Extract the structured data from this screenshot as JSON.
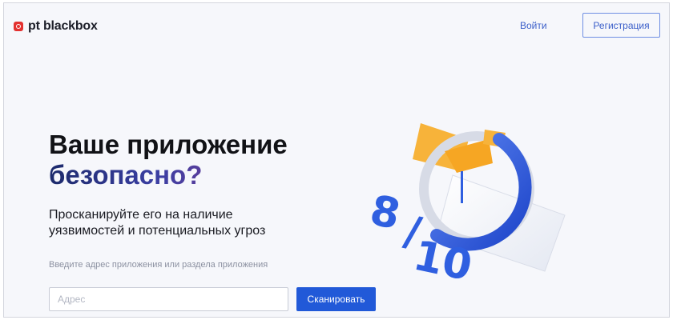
{
  "brand": {
    "name": "pt blackbox",
    "logo_icon": "pt-logo-icon",
    "accent": "#e3312f"
  },
  "header": {
    "login_label": "Войти",
    "register_label": "Регистрация"
  },
  "hero": {
    "title_line1": "Ваше приложение",
    "title_line2": "безопасно?",
    "subtitle_line1": "Просканируйте его на наличие",
    "subtitle_line2": "уязвимостей и потенциальных угроз",
    "input_hint": "Введите адрес приложения или раздела приложения",
    "input_placeholder": "Адрес",
    "input_value": "",
    "scan_label": "Сканировать"
  },
  "illustration": {
    "score_numerator": "8",
    "score_denominator": "10",
    "score_fraction": 0.8,
    "colors": {
      "ring": "#2f5fe0",
      "accent": "#f7b33a",
      "card": "#eef0f6"
    }
  }
}
